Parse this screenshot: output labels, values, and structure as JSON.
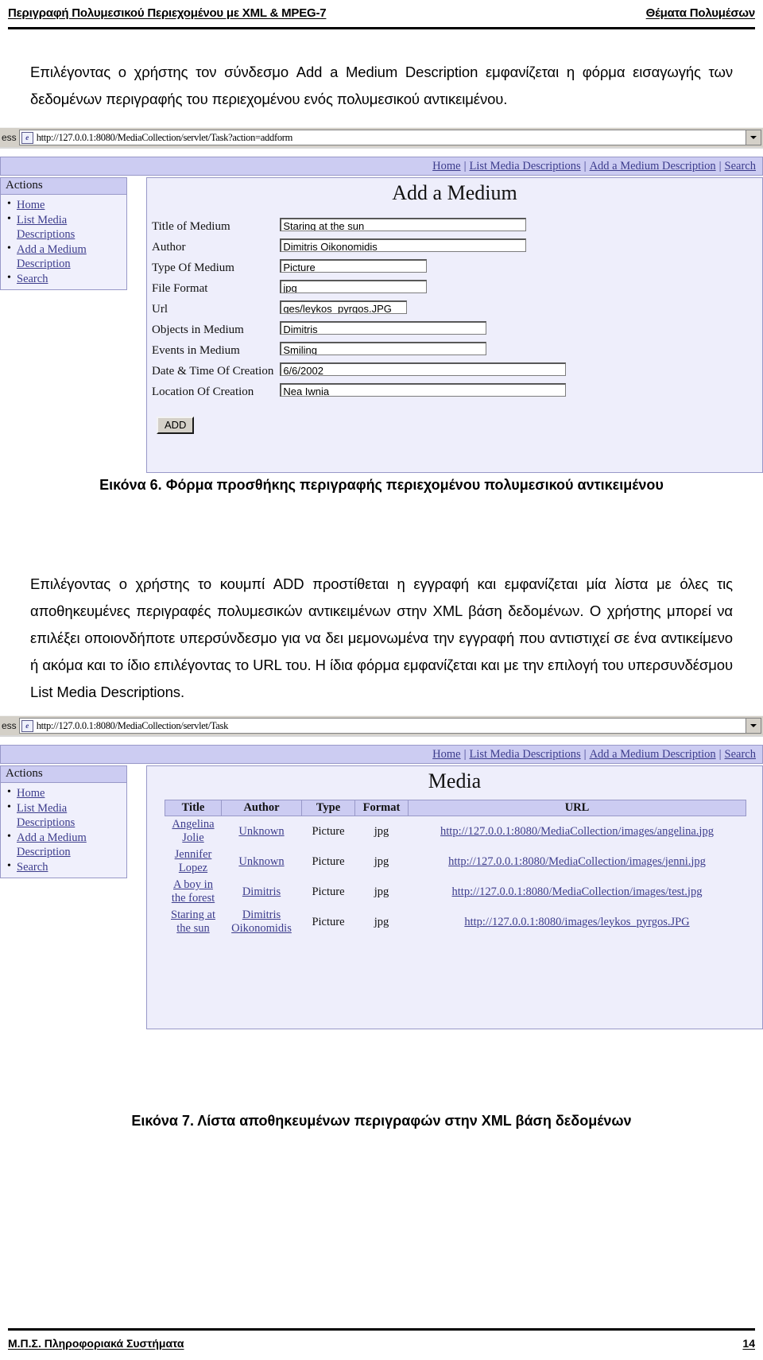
{
  "header": {
    "left": "Περιγραφή Πολυμεσικού Περιεχομένου με XML & MPEG-7",
    "right": "Θέματα Πολυμέσων"
  },
  "paragraph_1": "Επιλέγοντας ο χρήστης τον σύνδεσμο Add a Medium Description εμφανίζεται η φόρμα εισαγωγής των δεδομένων περιγραφής του περιεχομένου ενός πολυμεσικού αντικειμένου.",
  "figure6": {
    "caption": "Εικόνα 6. Φόρμα προσθήκης περιγραφής περιεχομένου πολυμεσικού αντικειμένου",
    "browser": {
      "address_label": "ess",
      "url": "http://127.0.0.1:8080/MediaCollection/servlet/Task?action=addform",
      "dropdown_icon": "chevron-down-icon",
      "ie_icon": "e"
    },
    "nav": {
      "items": [
        "Home",
        "List Media Descriptions",
        "Add a Medium Description",
        "Search"
      ],
      "separator": "|"
    },
    "sidebar": {
      "title": "Actions",
      "items": [
        "Home",
        "List Media Descriptions",
        "Add a Medium Description",
        "Search"
      ]
    },
    "page_title": "Add a Medium",
    "fields": [
      {
        "label": "Title of Medium",
        "value": "Staring at the sun",
        "width": "w-xl"
      },
      {
        "label": "Author",
        "value": "Dimitris Oikonomidis",
        "width": "w-xl"
      },
      {
        "label": "Type Of Medium",
        "value": "Picture",
        "width": "w-md"
      },
      {
        "label": "File Format",
        "value": "jpg",
        "width": "w-md"
      },
      {
        "label": "Url",
        "value": "ges/leykos_pyrgos.JPG",
        "width": "w-sm"
      },
      {
        "label": "Objects in Medium",
        "value": "Dimitris",
        "width": "w-lg"
      },
      {
        "label": "Events in Medium",
        "value": "Smiling",
        "width": "w-lg"
      },
      {
        "label": "Date & Time Of Creation",
        "value": "6/6/2002",
        "width": "w-xxl"
      },
      {
        "label": "Location Of Creation",
        "value": "Nea Iwnia",
        "width": "w-xxl"
      }
    ],
    "submit_label": "ADD"
  },
  "paragraph_2": "Επιλέγοντας ο χρήστης το κουμπί ADD προστίθεται η εγγραφή και εμφανίζεται μία λίστα με όλες τις αποθηκευμένες περιγραφές πολυμεσικών αντικειμένων στην XML βάση δεδομένων. Ο χρήστης μπορεί να επιλέξει οποιονδήποτε υπερσύνδεσμο για να δει μεμονωμένα την εγγραφή που αντιστιχεί σε ένα αντικείμενο ή ακόμα και το ίδιο επιλέγοντας το URL του. Η ίδια φόρμα εμφανίζεται και με την επιλογή του υπερσυνδέσμου List Media Descriptions.",
  "figure7": {
    "caption": "Εικόνα 7. Λίστα αποθηκευμένων περιγραφών στην XML βάση δεδομένων",
    "browser": {
      "address_label": "ess",
      "url": "http://127.0.0.1:8080/MediaCollection/servlet/Task",
      "dropdown_icon": "chevron-down-icon",
      "ie_icon": "e"
    },
    "nav": {
      "items": [
        "Home",
        "List Media Descriptions",
        "Add a Medium Description",
        "Search"
      ],
      "separator": "|"
    },
    "sidebar": {
      "title": "Actions",
      "items": [
        "Home",
        "List Media Descriptions",
        "Add a Medium Description",
        "Search"
      ]
    },
    "page_title": "Media",
    "table": {
      "columns": [
        "Title",
        "Author",
        "Type",
        "Format",
        "URL"
      ],
      "rows": [
        {
          "title": "Angelina Jolie",
          "author": "Unknown",
          "type": "Picture",
          "format": "jpg",
          "url": "http://127.0.0.1:8080/MediaCollection/images/angelina.jpg"
        },
        {
          "title": "Jennifer Lopez",
          "author": "Unknown",
          "type": "Picture",
          "format": "jpg",
          "url": "http://127.0.0.1:8080/MediaCollection/images/jenni.jpg"
        },
        {
          "title": "A boy in the forest",
          "author": "Dimitris",
          "type": "Picture",
          "format": "jpg",
          "url": "http://127.0.0.1:8080/MediaCollection/images/test.jpg"
        },
        {
          "title": "Staring at the sun",
          "author": "Dimitris Oikonomidis",
          "type": "Picture",
          "format": "jpg",
          "url": "http://127.0.0.1:8080/images/leykos_pyrgos.JPG"
        }
      ]
    }
  },
  "footer": {
    "left": "Μ.Π.Σ. Πληροφοριακά Συστήματα",
    "page_number": "14"
  }
}
